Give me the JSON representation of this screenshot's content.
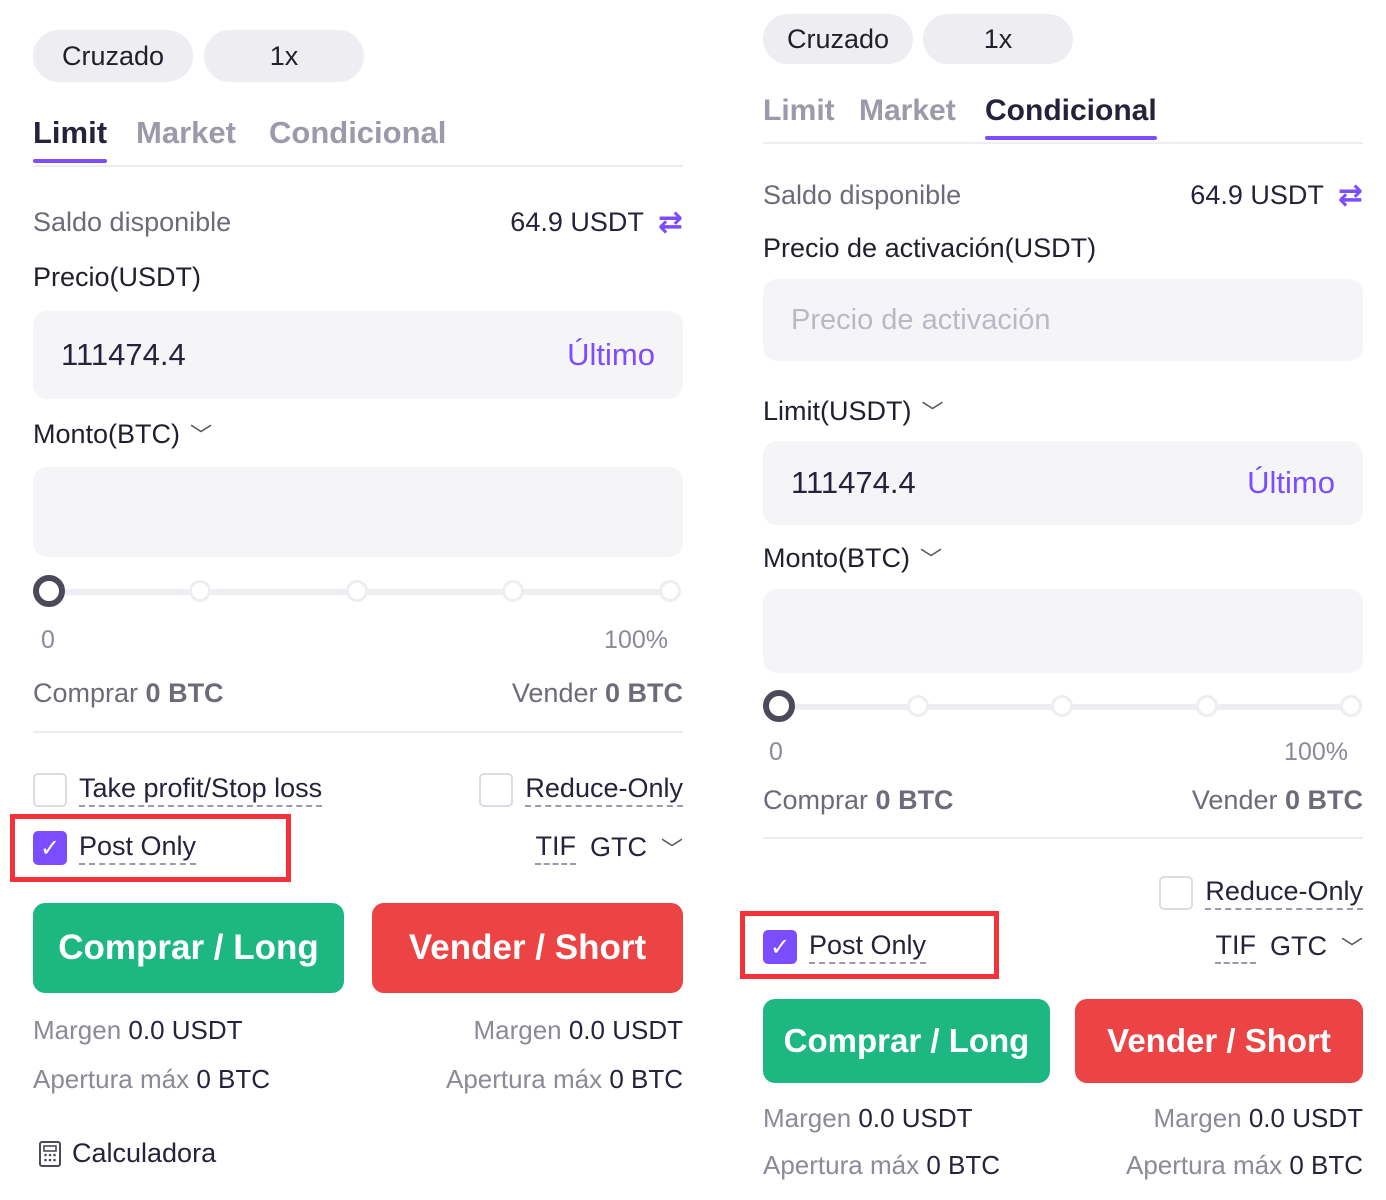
{
  "left": {
    "margin_mode": "Cruzado",
    "leverage": "1x",
    "tabs": [
      "Limit",
      "Market",
      "Condicional"
    ],
    "active_tab": "Limit",
    "balance_label": "Saldo disponible",
    "balance_value": "64.9 USDT",
    "price_label": "Precio(USDT)",
    "price_value": "111474.4",
    "latest_label": "Último",
    "amount_label": "Monto(BTC)",
    "slider_min": "0",
    "slider_max": "100%",
    "buy_label": "Comprar",
    "buy_value": "0 BTC",
    "sell_label": "Vender",
    "sell_value": "0 BTC",
    "tpsl_label": "Take profit/Stop loss",
    "reduce_only_label": "Reduce-Only",
    "post_only_label": "Post Only",
    "tif_label": "TIF",
    "tif_value": "GTC",
    "buy_button": "Comprar / Long",
    "sell_button": "Vender / Short",
    "margin_label": "Margen",
    "margin_value": "0.0 USDT",
    "max_open_label": "Apertura máx",
    "max_open_value": "0 BTC",
    "calculator_label": "Calculadora"
  },
  "right": {
    "margin_mode": "Cruzado",
    "leverage": "1x",
    "tabs": [
      "Limit",
      "Market",
      "Condicional"
    ],
    "active_tab": "Condicional",
    "balance_label": "Saldo disponible",
    "balance_value": "64.9 USDT",
    "trigger_label": "Precio de activación(USDT)",
    "trigger_placeholder": "Precio de activación",
    "limit_label": "Limit(USDT)",
    "limit_value": "111474.4",
    "latest_label": "Último",
    "amount_label": "Monto(BTC)",
    "slider_min": "0",
    "slider_max": "100%",
    "buy_label": "Comprar",
    "buy_value": "0 BTC",
    "sell_label": "Vender",
    "sell_value": "0 BTC",
    "reduce_only_label": "Reduce-Only",
    "post_only_label": "Post Only",
    "tif_label": "TIF",
    "tif_value": "GTC",
    "buy_button": "Comprar / Long",
    "sell_button": "Vender / Short",
    "margin_label": "Margen",
    "margin_value": "0.0 USDT",
    "max_open_label": "Apertura máx",
    "max_open_value": "0 BTC"
  },
  "colors": {
    "accent": "#7c4dff",
    "buy": "#1db882",
    "sell": "#ec4444",
    "highlight": "#f3323a"
  }
}
